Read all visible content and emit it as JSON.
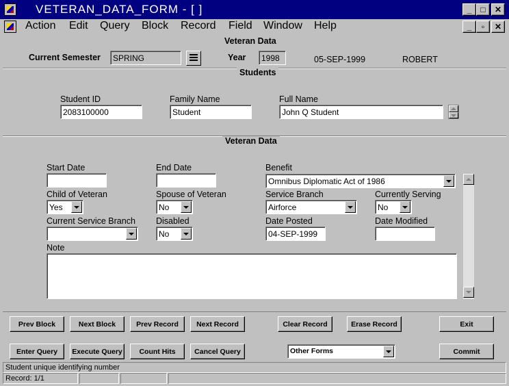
{
  "window": {
    "title": "VETERAN_DATA_FORM - [ ]",
    "controls": {
      "minimize": "_",
      "maximize": "□",
      "close": "✕",
      "restore": "▫"
    }
  },
  "menu": [
    "Action",
    "Edit",
    "Query",
    "Block",
    "Record",
    "Field",
    "Window",
    "Help"
  ],
  "header": {
    "section_title": "Veteran Data",
    "semester_label": "Current Semester",
    "semester_value": "SPRING",
    "year_label": "Year",
    "year_value": "1998",
    "date": "05-SEP-1999",
    "user": "ROBERT"
  },
  "students": {
    "section_title": "Students",
    "student_id_label": "Student ID",
    "student_id_value": "2083100000",
    "family_name_label": "Family Name",
    "family_name_value": "Student",
    "full_name_label": "Full Name",
    "full_name_value": "John Q Student"
  },
  "veteran": {
    "section_title": "Veteran Data",
    "start_date_label": "Start Date",
    "start_date_value": "",
    "end_date_label": "End Date",
    "end_date_value": "",
    "benefit_label": "Benefit",
    "benefit_value": "Omnibus Diplomatic Act of 1986",
    "child_label": "Child of Veteran",
    "child_value": "Yes",
    "spouse_label": "Spouse of Veteran",
    "spouse_value": "No",
    "branch_label": "Service Branch",
    "branch_value": "Airforce",
    "serving_label": "Currently Serving",
    "serving_value": "No",
    "current_branch_label": "Current Service Branch",
    "current_branch_value": "",
    "disabled_label": "Disabled",
    "disabled_value": "No",
    "date_posted_label": "Date Posted",
    "date_posted_value": "04-SEP-1999",
    "date_modified_label": "Date Modified",
    "date_modified_value": "",
    "note_label": "Note",
    "note_value": ""
  },
  "buttons": {
    "prev_block": "Prev Block",
    "next_block": "Next Block",
    "prev_record": "Prev Record",
    "next_record": "Next Record",
    "clear_record": "Clear Record",
    "erase_record": "Erase Record",
    "exit": "Exit",
    "enter_query": "Enter Query",
    "execute_query": "Execute Query",
    "count_hits": "Count Hits",
    "cancel_query": "Cancel Query",
    "other_forms": "Other Forms",
    "commit": "Commit"
  },
  "status": {
    "hint": "Student unique identifying number",
    "record": "Record: 1/1"
  },
  "colors": {
    "titlebar": "#000080",
    "face": "#c0c0c0"
  }
}
